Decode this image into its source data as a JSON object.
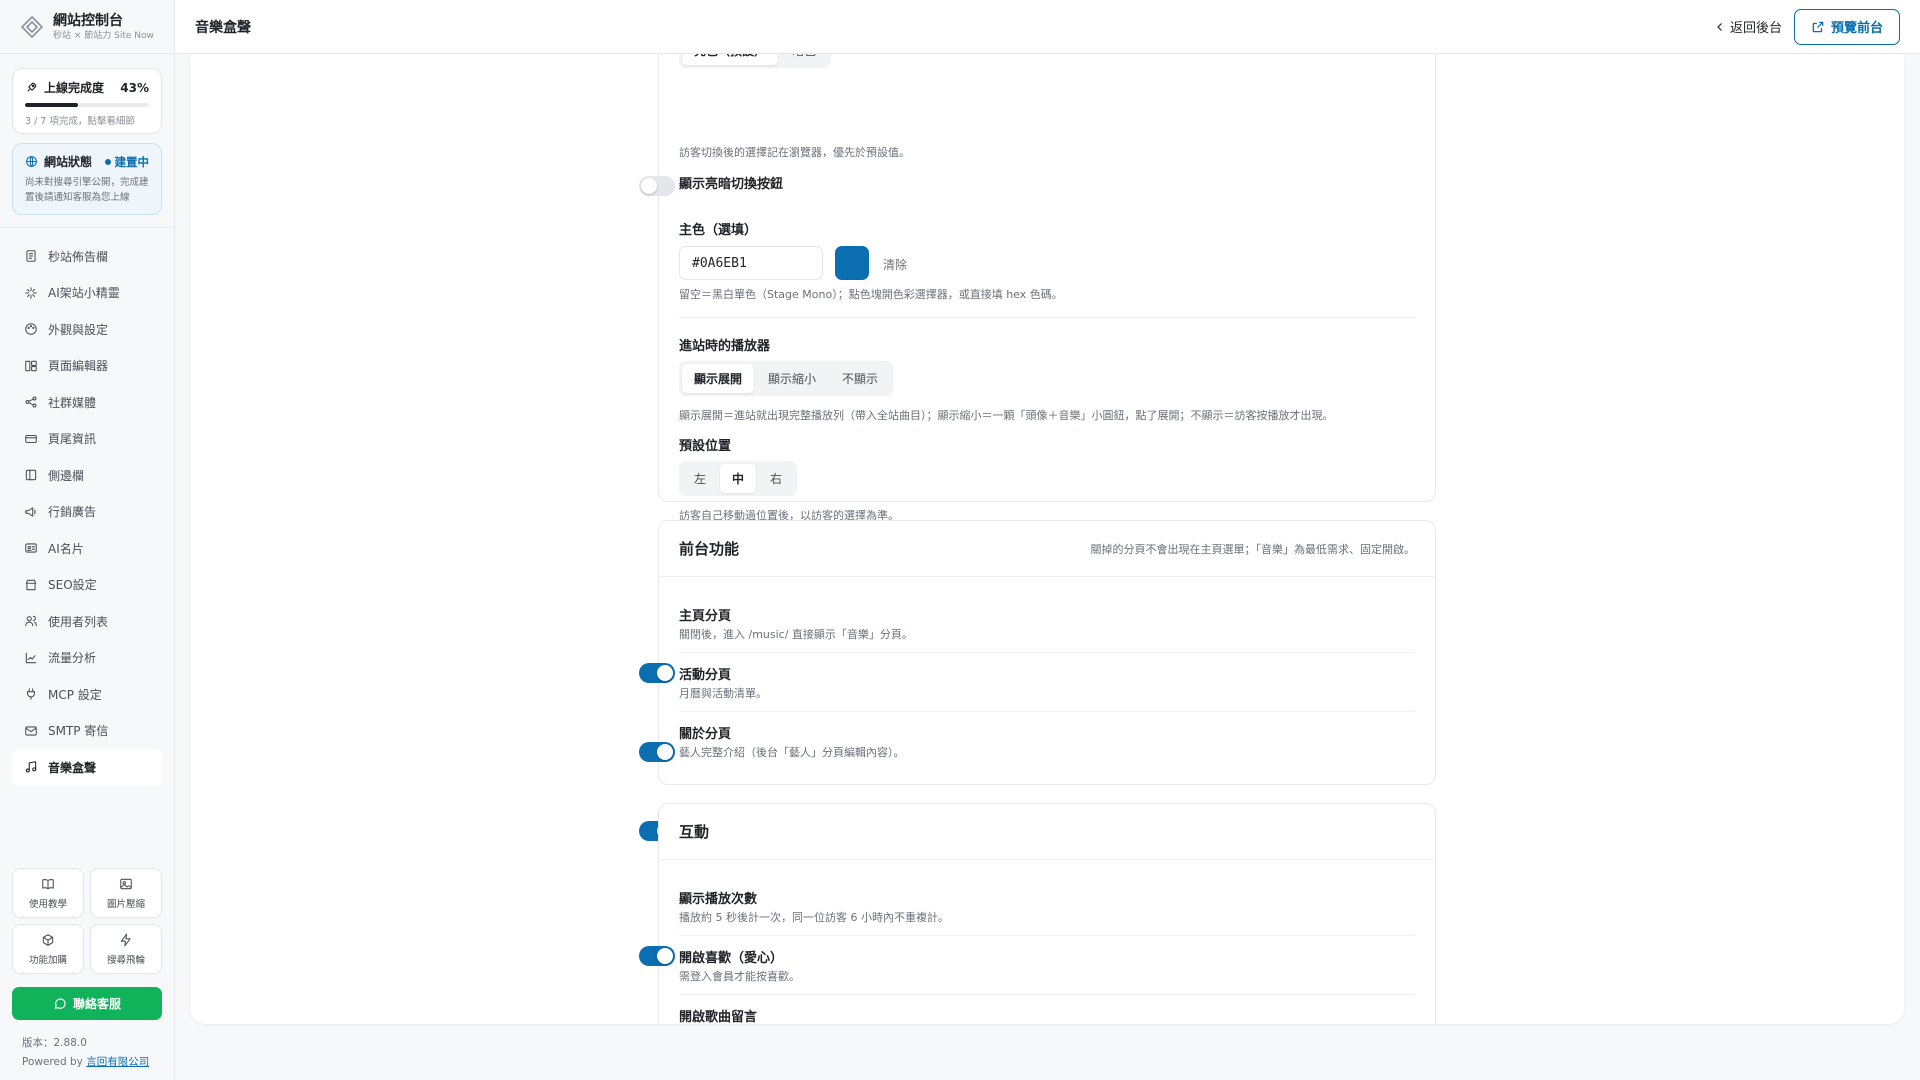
{
  "brand": {
    "title": "網站控制台",
    "subtitle": "秒站 × 節站力 Site Now"
  },
  "progress": {
    "label": "上線完成度",
    "percent_text": "43%",
    "fraction": 0.43,
    "sub": "3 / 7 項完成，點擊看細節"
  },
  "site_status": {
    "label": "網站狀態",
    "badge": "建置中",
    "desc": "尚未對搜尋引擎公開，完成建置後請通知客服為您上線"
  },
  "nav": [
    {
      "label": "秒站佈告欄",
      "icon": "notice-board-icon"
    },
    {
      "label": "AI架站小精靈",
      "icon": "sparkle-icon"
    },
    {
      "label": "外觀與設定",
      "icon": "palette-icon"
    },
    {
      "label": "頁面編輯器",
      "icon": "layout-icon"
    },
    {
      "label": "社群媒體",
      "icon": "share-icon"
    },
    {
      "label": "頁尾資訊",
      "icon": "card-icon"
    },
    {
      "label": "側邊欄",
      "icon": "sidebar-icon"
    },
    {
      "label": "行銷廣告",
      "icon": "megaphone-icon"
    },
    {
      "label": "AI名片",
      "icon": "id-card-icon"
    },
    {
      "label": "SEO設定",
      "icon": "store-icon"
    },
    {
      "label": "使用者列表",
      "icon": "users-icon"
    },
    {
      "label": "流量分析",
      "icon": "chart-line-icon"
    },
    {
      "label": "MCP 設定",
      "icon": "plug-icon"
    },
    {
      "label": "SMTP 寄信",
      "icon": "mail-icon"
    },
    {
      "label": "音樂盒聲",
      "icon": "music-note-icon",
      "active": true
    }
  ],
  "quick": [
    {
      "label": "使用教學",
      "icon": "book-icon"
    },
    {
      "label": "圖片壓縮",
      "icon": "image-icon"
    },
    {
      "label": "功能加購",
      "icon": "package-icon"
    },
    {
      "label": "搜尋飛輪",
      "icon": "bolt-icon"
    }
  ],
  "support_button": "聯絡客服",
  "version": {
    "label": "版本：2.88.0",
    "powered_prefix": "Powered by ",
    "company": "言回有限公司"
  },
  "topbar": {
    "title": "音樂盒聲",
    "back": "返回後台",
    "preview": "預覽前台"
  },
  "appearance": {
    "theme_options": [
      "亮色（預設）",
      "暗色"
    ],
    "theme_desc": "訪客切換後的選擇記在瀏覽器，優先於預設值。",
    "show_toggle_label": "顯示亮暗切換按鈕",
    "show_toggle_on": false,
    "primary_label": "主色（選填）",
    "primary_value": "#0A6EB1",
    "primary_color": "#0a6eb1",
    "clear": "清除",
    "primary_desc": "留空＝黑白單色（Stage Mono）；點色塊開色彩選擇器，或直接填 hex 色碼。",
    "player_label": "進站時的播放器",
    "player_options": [
      "顯示展開",
      "顯示縮小",
      "不顯示"
    ],
    "player_selected": 0,
    "player_desc": "顯示展開＝進站就出現完整播放列（帶入全站曲目）；顯示縮小＝一顆「頭像＋音樂」小圓鈕，點了展開；不顯示＝訪客按播放才出現。",
    "position_label": "預設位置",
    "position_options": [
      "左",
      "中",
      "右"
    ],
    "position_selected": 1,
    "position_desc": "訪客自己移動過位置後，以訪客的選擇為準。"
  },
  "frontend": {
    "title": "前台功能",
    "hint": "關掉的分頁不會出現在主頁選單；「音樂」為最低需求、固定開啟。",
    "items": [
      {
        "label": "主頁分頁",
        "desc": "關閉後，進入 /music/ 直接顯示「音樂」分頁。",
        "on": true
      },
      {
        "label": "活動分頁",
        "desc": "月曆與活動清單。",
        "on": true
      },
      {
        "label": "關於分頁",
        "desc": "藝人完整介紹（後台「藝人」分頁編輯內容）。",
        "on": true
      }
    ]
  },
  "interaction": {
    "title": "互動",
    "items": [
      {
        "label": "顯示播放次數",
        "desc": "播放約 5 秒後計一次，同一位訪客 6 小時內不重複計。",
        "on": true
      },
      {
        "label": "開啟喜歡（愛心）",
        "desc": "需登入會員才能按喜歡。",
        "on": true
      },
      {
        "label": "開啟歌曲留言",
        "desc": "",
        "on": true
      }
    ]
  }
}
